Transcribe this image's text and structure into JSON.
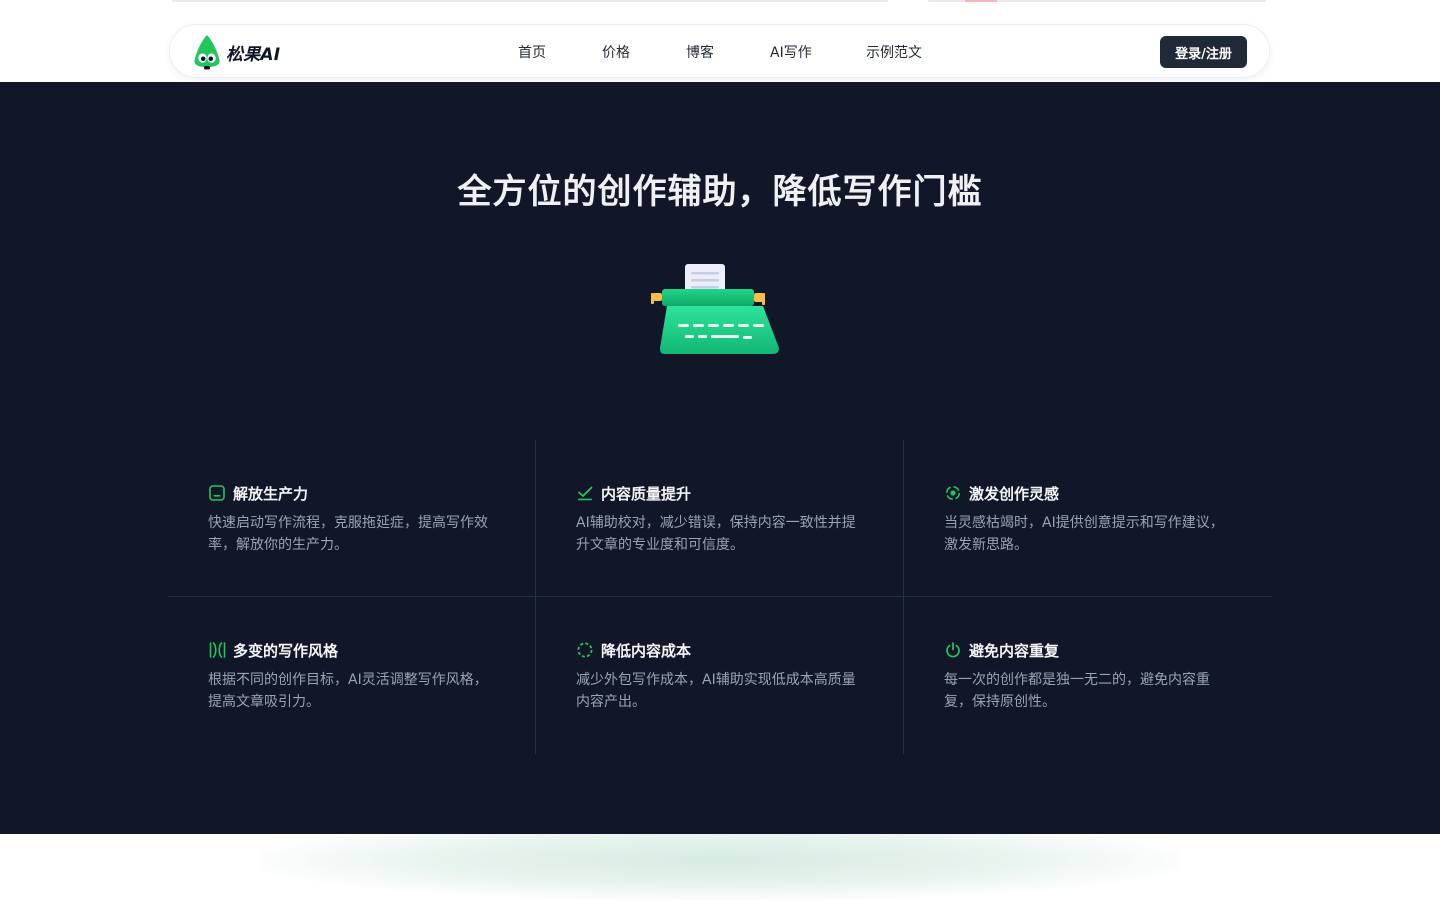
{
  "brand": {
    "name": "松果AI",
    "logo_icon": "pine-cone-mascot-icon",
    "accent": "#22c55e"
  },
  "nav": {
    "links": [
      {
        "label": "首页"
      },
      {
        "label": "价格"
      },
      {
        "label": "博客"
      },
      {
        "label": "AI写作"
      },
      {
        "label": "示例范文"
      }
    ],
    "login_label": "登录/注册"
  },
  "hero": {
    "title": "全方位的创作辅助，降低写作门槛",
    "illustration_icon": "typewriter-icon",
    "background": "#111729"
  },
  "features": [
    {
      "icon": "productivity-icon",
      "title": "解放生产力",
      "desc": "快速启动写作流程，克服拖延症，提高写作效率，解放你的生产力。"
    },
    {
      "icon": "check-icon",
      "title": "内容质量提升",
      "desc": "AI辅助校对，减少错误，保持内容一致性并提升文章的专业度和可信度。"
    },
    {
      "icon": "inspiration-icon",
      "title": "激发创作灵感",
      "desc": "当灵感枯竭时，AI提供创意提示和写作建议，激发新思路。"
    },
    {
      "icon": "style-icon",
      "title": "多变的写作风格",
      "desc": "根据不同的创作目标，AI灵活调整写作风格，提高文章吸引力。"
    },
    {
      "icon": "cost-icon",
      "title": "降低内容成本",
      "desc": "减少外包写作成本，AI辅助实现低成本高质量内容产出。"
    },
    {
      "icon": "power-icon",
      "title": "避免内容重复",
      "desc": "每一次的创作都是独一无二的，避免内容重复，保持原创性。"
    }
  ]
}
